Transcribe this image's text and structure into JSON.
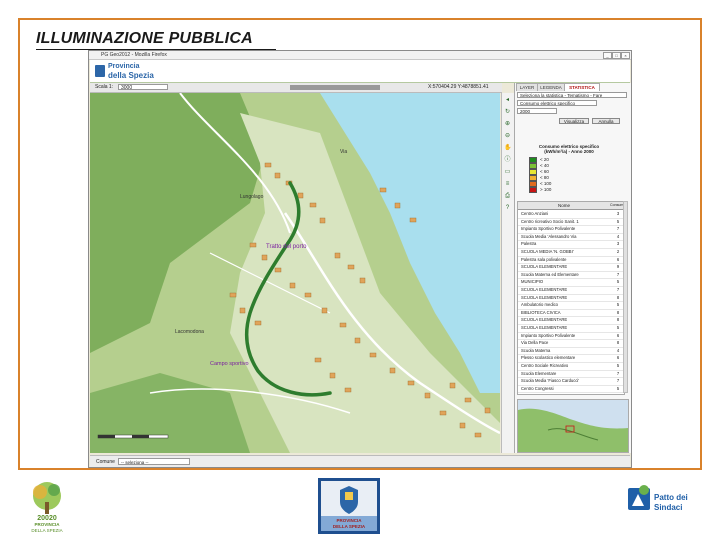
{
  "slide": {
    "title": "ILLUMINAZIONE PUBBLICA"
  },
  "window": {
    "title": "PG Geo2012 - Mozilla Firefox",
    "brand_line1": "Provincia",
    "brand_line2": "della Spezia"
  },
  "map_toolbar": {
    "scale_label": "Scala 1:",
    "scale_value": "3000",
    "coordinates": "X:570404.29  Y:4878851.41"
  },
  "map": {
    "labels": [
      "Tratto del porto",
      "Campo sportivo",
      "Lungolago",
      "Lacomodona",
      "Via"
    ]
  },
  "right_panel": {
    "tabs": [
      "LAYER",
      "LEGENDA",
      "STATISTICA"
    ],
    "active_tab": "STATISTICA",
    "analysis_select": "Seleziona la statistica - Tematismo - Fare",
    "type_select": "Consumo elettrico specifico",
    "year_select": "2000",
    "buttons": {
      "view": "Visualizza",
      "cancel": "Annulla"
    },
    "legend_title": "Consumo elettrico specifico (kWh/m²/a) - Anno 2000",
    "legend": [
      {
        "label": "< 20",
        "color": "#1e8c1e"
      },
      {
        "label": "< 40",
        "color": "#7cc236"
      },
      {
        "label": "< 60",
        "color": "#e6e633"
      },
      {
        "label": "< 80",
        "color": "#f0b030"
      },
      {
        "label": "< 100",
        "color": "#e06a1e"
      },
      {
        "label": "> 100",
        "color": "#c81414"
      }
    ],
    "table_headers": {
      "name": "Nome",
      "consumption": "Consumo"
    },
    "table_rows": [
      {
        "name": "Centro Anziani",
        "value": "3"
      },
      {
        "name": "Centro ricreativo Socio Sanit. 1",
        "value": "5"
      },
      {
        "name": "Impianto Sportivo Polivalente",
        "value": "7"
      },
      {
        "name": "Scuola Media 'Alessandro Via",
        "value": "4"
      },
      {
        "name": "Palestra",
        "value": "3"
      },
      {
        "name": "SCUOLA MEDIA 'N. GOBBI'",
        "value": "2"
      },
      {
        "name": "Palestra sala polivalente",
        "value": "6"
      },
      {
        "name": "SCUOLA ELEMENTARE",
        "value": "9"
      },
      {
        "name": "Scuola Materna ed Elementare",
        "value": "7"
      },
      {
        "name": "MUNICIPIO",
        "value": "5"
      },
      {
        "name": "SCUOLA ELEMENTARE",
        "value": "7"
      },
      {
        "name": "SCUOLA ELEMENTARE",
        "value": "8"
      },
      {
        "name": "Ambulatorio medico",
        "value": "5"
      },
      {
        "name": "BIBLIOTECA CIVICA",
        "value": "8"
      },
      {
        "name": "SCUOLA ELEMENTARE",
        "value": "8"
      },
      {
        "name": "SCUOLA ELEMENTARE",
        "value": "5"
      },
      {
        "name": "Impianto Sportivo Polivalente",
        "value": "6"
      },
      {
        "name": "Via Della Pace",
        "value": "8"
      },
      {
        "name": "Scuola Materna",
        "value": "4"
      },
      {
        "name": "Plesso scolastico elementare",
        "value": "6"
      },
      {
        "name": "Centro Sociale Ricreativo",
        "value": "5"
      },
      {
        "name": "Scuola Elementare",
        "value": "7"
      },
      {
        "name": "Scuola Media 'Fiasco Carducci'",
        "value": "7"
      },
      {
        "name": "Centro Congressi",
        "value": "5"
      }
    ]
  },
  "status_bar": {
    "comune_label": "Comune",
    "comune_value": "-- seleziona -- "
  },
  "footer": {
    "logo_left_lines": [
      "20020",
      "PROVINCIA",
      "DELLA SPEZIA"
    ],
    "logo_center_lines": [
      "PROVINCIA",
      "DELLA SPEZIA"
    ],
    "logo_right_lines": [
      "Patto dei",
      "Sindaci"
    ]
  }
}
